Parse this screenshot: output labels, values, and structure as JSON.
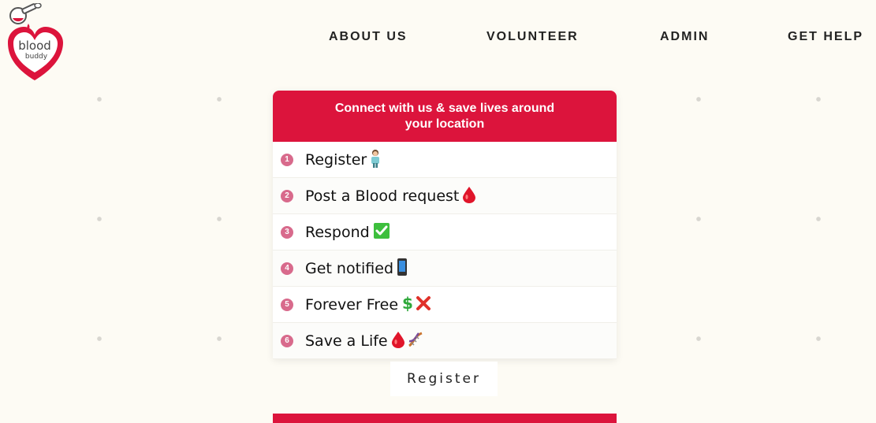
{
  "brand": {
    "logo_line1": "blood",
    "logo_line2": "buddy",
    "colors": {
      "accent": "#dc143c",
      "step_badge": "#d86a8c",
      "background": "#fdfbf4"
    }
  },
  "nav": {
    "items": [
      {
        "label": "ABOUT US"
      },
      {
        "label": "VOLUNTEER"
      },
      {
        "label": "ADMIN"
      },
      {
        "label": "GET HELP"
      }
    ]
  },
  "card": {
    "title": "Connect with us & save lives around your location",
    "steps": [
      {
        "num": "1",
        "text": "Register",
        "icons": [
          "health-worker-icon"
        ]
      },
      {
        "num": "2",
        "text": "Post a Blood request",
        "icons": [
          "blood-drop-icon"
        ]
      },
      {
        "num": "3",
        "text": "Respond",
        "icons": [
          "check-mark-icon"
        ]
      },
      {
        "num": "4",
        "text": "Get notified",
        "icons": [
          "mobile-phone-icon"
        ]
      },
      {
        "num": "5",
        "text": "Forever Free",
        "icons": [
          "dollar-sign-icon",
          "cross-mark-icon"
        ]
      },
      {
        "num": "6",
        "text": "Save a Life",
        "icons": [
          "blood-drop-icon",
          "dna-icon"
        ]
      }
    ]
  },
  "register_button": {
    "label": "Register"
  }
}
